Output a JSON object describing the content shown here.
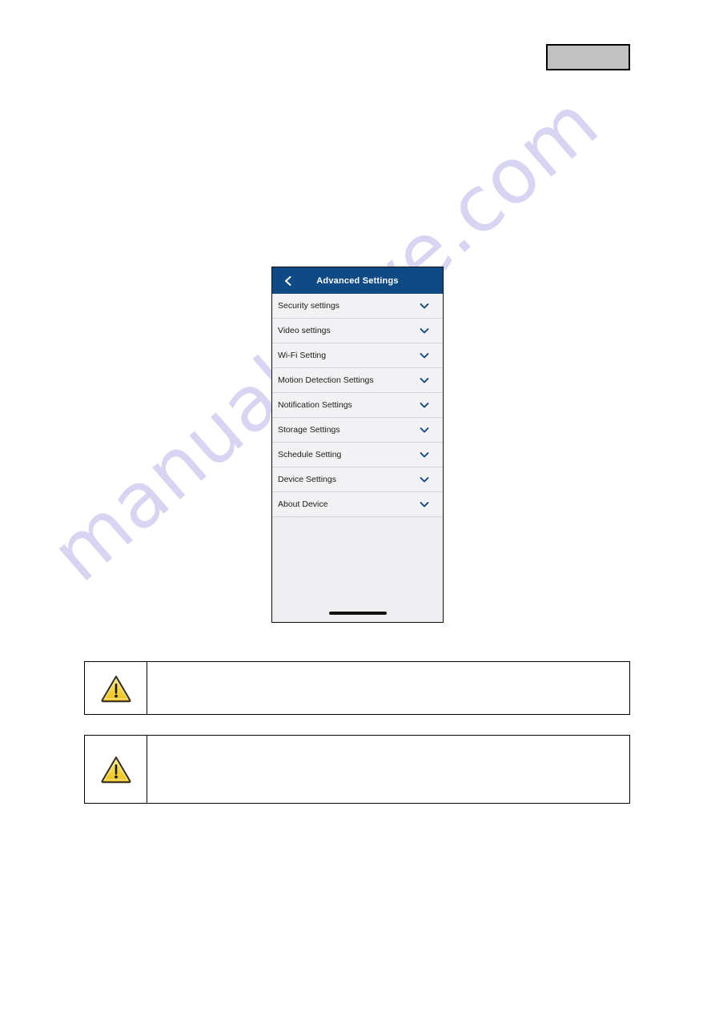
{
  "document": {
    "background_color": "#ffffff",
    "watermark_text": "manualshive.com",
    "watermark_color": "#c9c6ee"
  },
  "header_box": {
    "name": "header-placeholder-box",
    "fill_color": "#c1c1c1",
    "border_color": "#000000",
    "text": ""
  },
  "phone": {
    "topbar": {
      "title": "Advanced Settings",
      "background_color": "#0f4a85",
      "title_color": "#ffffff",
      "back_icon": "chevron-left-icon"
    },
    "list_background_color": "#f2f2f5",
    "chevron_color": "#0f4a85",
    "items": [
      {
        "label": "Security settings",
        "icon": "chevron-down-icon"
      },
      {
        "label": "Video settings",
        "icon": "chevron-down-icon"
      },
      {
        "label": "Wi-Fi Setting",
        "icon": "chevron-down-icon"
      },
      {
        "label": "Motion Detection Settings",
        "icon": "chevron-down-icon"
      },
      {
        "label": "Notification Settings",
        "icon": "chevron-down-icon"
      },
      {
        "label": "Storage Settings",
        "icon": "chevron-down-icon"
      },
      {
        "label": "Schedule Setting",
        "icon": "chevron-down-icon"
      },
      {
        "label": "Device Settings",
        "icon": "chevron-down-icon"
      },
      {
        "label": "About Device",
        "icon": "chevron-down-icon"
      }
    ],
    "home_indicator": true
  },
  "notes": [
    {
      "icon": "warning-triangle-icon",
      "icon_fill": "#f5d033",
      "text": ""
    },
    {
      "icon": "warning-triangle-icon",
      "icon_fill": "#f5d033",
      "text": ""
    }
  ]
}
